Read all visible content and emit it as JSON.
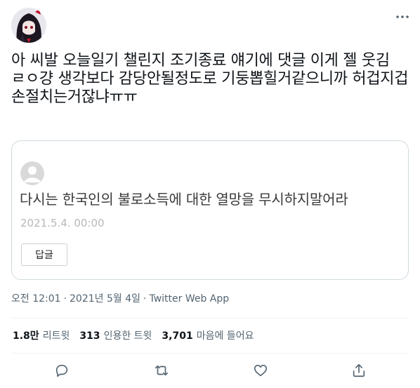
{
  "tweet": {
    "text": "아 씨발 오늘일기 챌린지 조기종료 얘기에 댓글 이게 젤 웃김\nㄹㅇ걍 생각보다 감당안될정도로 기둥뽑힐거같으니까 허겁지겁 손절치는거잖냐ㅠㅠ",
    "author_avatar_icon": "profile-avatar"
  },
  "quote": {
    "avatar_icon": "default-avatar",
    "text": "다시는 한국인의 불로소득에 대한 열망을 무시하지말어라",
    "date": "2021.5.4. 00:00",
    "reply_label": "답글"
  },
  "meta": {
    "time": "오전 12:01",
    "date": "2021년 5월 4일",
    "separator": "·",
    "source": "Twitter Web App"
  },
  "stats": {
    "retweets_count": "1.8만",
    "retweets_label": "리트윗",
    "quotes_count": "313",
    "quotes_label": "인용한 트윗",
    "likes_count": "3,701",
    "likes_label": "마음에 들어요"
  },
  "actions": [
    "reply-icon",
    "retweet-icon",
    "like-icon",
    "share-icon"
  ],
  "colors": {
    "text": "#0f1419",
    "secondary": "#536471",
    "border": "#cfd9de",
    "quote_date": "#b8b8b8"
  }
}
